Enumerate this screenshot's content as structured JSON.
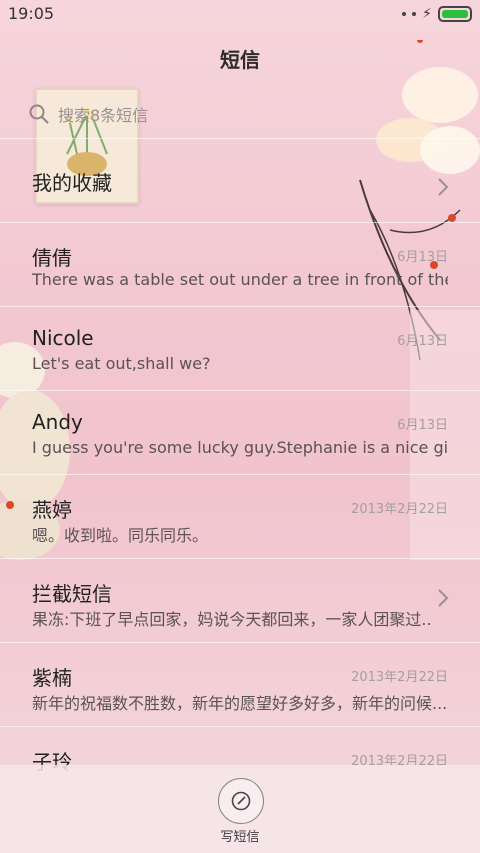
{
  "status_bar": {
    "time": "19:05",
    "battery_color": "#2bbf3b"
  },
  "header": {
    "title": "短信"
  },
  "search": {
    "placeholder": "搜索8条短信"
  },
  "conversations": [
    {
      "name": "我的收藏",
      "date": "",
      "preview": "",
      "has_chevron": true
    },
    {
      "name": "倩倩",
      "date": "6月13日",
      "preview": "There was a table set out under a tree in front of the ho..."
    },
    {
      "name": "Nicole",
      "date": "6月13日",
      "preview": "Let's eat out,shall we?"
    },
    {
      "name": "Andy",
      "date": "6月13日",
      "preview": "I guess you're some lucky guy.Stephanie is a nice girl."
    },
    {
      "name": "燕婷",
      "date": "2013年2月22日",
      "preview": "嗯。收到啦。同乐同乐。"
    },
    {
      "name": "拦截短信",
      "date": "",
      "preview": "果冻:下班了早点回家，妈说今天都回来，一家人团聚过...",
      "has_chevron": true
    },
    {
      "name": "紫楠",
      "date": "2013年2月22日",
      "preview": "新年的祝福数不胜数，新年的愿望好多好多，新年的问候..."
    },
    {
      "name": "子玲",
      "date": "2013年2月22日",
      "preview": ""
    }
  ],
  "compose": {
    "label": "写短信"
  },
  "colors": {
    "background": "#f3c9d2",
    "text": "#222222",
    "date": "#a59ea0"
  }
}
